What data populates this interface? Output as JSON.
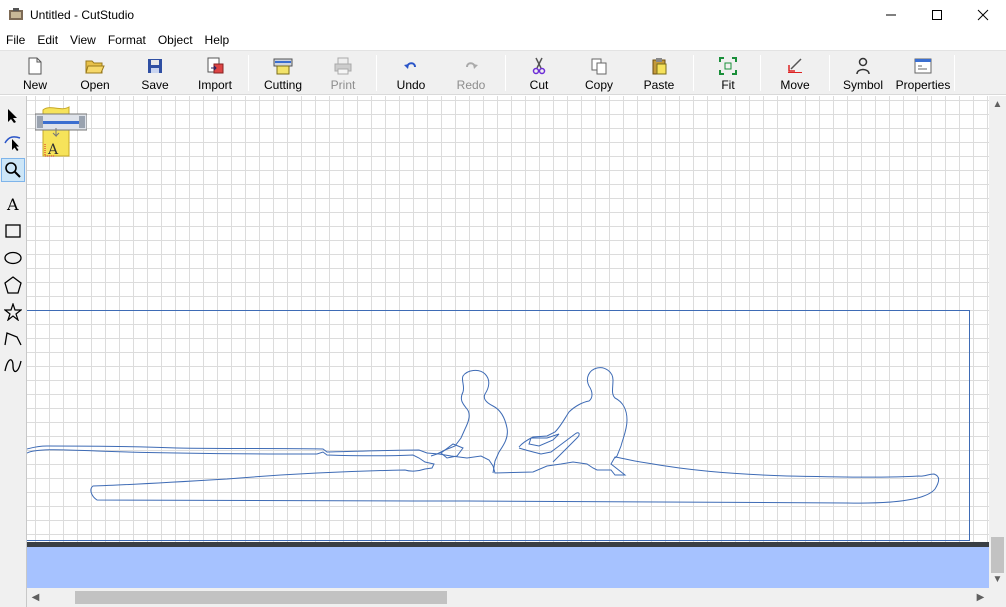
{
  "window": {
    "title": "Untitled - CutStudio",
    "controls": {
      "minimize": "minimize-icon",
      "maximize": "maximize-icon",
      "close": "close-icon"
    }
  },
  "menu": [
    "File",
    "Edit",
    "View",
    "Format",
    "Object",
    "Help"
  ],
  "toolbar": {
    "new": "New",
    "open": "Open",
    "save": "Save",
    "import": "Import",
    "cutting": "Cutting",
    "print": "Print",
    "undo": "Undo",
    "redo": "Redo",
    "cut": "Cut",
    "copy": "Copy",
    "paste": "Paste",
    "fit": "Fit",
    "move": "Move",
    "symbol": "Symbol",
    "properties": "Properties"
  },
  "toolbar_disabled": [
    "Print",
    "Redo"
  ],
  "tools": [
    "select-arrow-icon",
    "node-edit-icon",
    "zoom-icon",
    "text-icon",
    "rectangle-icon",
    "ellipse-icon",
    "polygon-icon",
    "star-icon",
    "polyline-icon",
    "curve-icon"
  ],
  "active_tool": "zoom-icon",
  "colors": {
    "grid": "#dcdcdc",
    "outline": "#3e6bb5",
    "plot_area": "#a6c2ff",
    "toolbar_bg": "#f0f0f0"
  }
}
